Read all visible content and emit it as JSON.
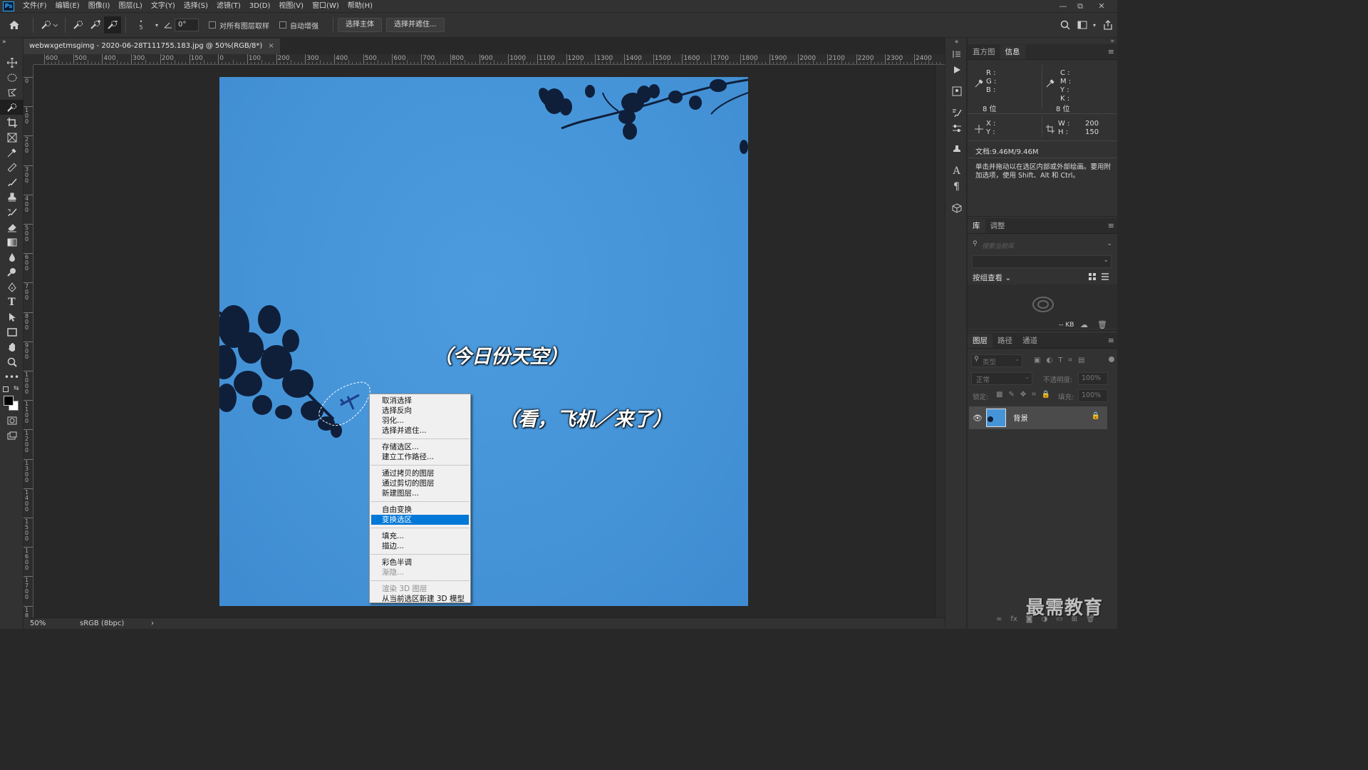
{
  "app": {
    "logo": "Ps"
  },
  "menubar": {
    "items": [
      "文件(F)",
      "编辑(E)",
      "图像(I)",
      "图层(L)",
      "文字(Y)",
      "选择(S)",
      "滤镜(T)",
      "3D(D)",
      "视图(V)",
      "窗口(W)",
      "帮助(H)"
    ]
  },
  "window_controls": {
    "minimize": "—",
    "restore": "⧉",
    "close": "✕"
  },
  "options": {
    "brush_size": "5",
    "angle": "0°",
    "sample_all_layers": "对所有图层取样",
    "auto_enhance": "自动增强",
    "select_subject": "选择主体",
    "select_and_mask": "选择并遮住..."
  },
  "document": {
    "tab_title": "webwxgetmsgimg - 2020-06-28T111755.183.jpg @ 50%(RGB/8*)",
    "close": "×"
  },
  "ruler": {
    "top_labels": [
      "600",
      "500",
      "400",
      "300",
      "200",
      "100",
      "0",
      "100",
      "200",
      "300",
      "400",
      "500",
      "600",
      "700",
      "800",
      "900",
      "1000",
      "1100",
      "1200",
      "1300",
      "1400",
      "1500",
      "1600",
      "1700",
      "1800",
      "1900",
      "2000",
      "2100",
      "2200",
      "2300",
      "2400"
    ],
    "left_labels": [
      "0",
      "1 0 0",
      "2 0 0",
      "3 0 0",
      "4 0 0",
      "5 0 0",
      "6 0 0",
      "7 0 0",
      "8 0 0",
      "9 0 0",
      "1 0 0 0",
      "1 1 0 0",
      "1 2 0 0",
      "1 3 0 0",
      "1 4 0 0",
      "1 5 0 0",
      "1 6 0 0",
      "1 7 0 0",
      "1 8 0 0"
    ]
  },
  "image": {
    "caption1": "（今日份天空）",
    "caption2": "（看，飞机／来了）",
    "sky_color": "#4694d8"
  },
  "context_menu": {
    "groups": [
      [
        {
          "label": "取消选择"
        },
        {
          "label": "选择反向"
        },
        {
          "label": "羽化..."
        },
        {
          "label": "选择并遮住..."
        }
      ],
      [
        {
          "label": "存储选区..."
        },
        {
          "label": "建立工作路径..."
        }
      ],
      [
        {
          "label": "通过拷贝的图层"
        },
        {
          "label": "通过剪切的图层"
        },
        {
          "label": "新建图层..."
        }
      ],
      [
        {
          "label": "自由变换"
        },
        {
          "label": "变换选区",
          "selected": true
        }
      ],
      [
        {
          "label": "填充..."
        },
        {
          "label": "描边..."
        }
      ],
      [
        {
          "label": "彩色半调"
        },
        {
          "label": "渐隐...",
          "disabled": true
        }
      ],
      [
        {
          "label": "渲染 3D 图层",
          "disabled": true
        },
        {
          "label": "从当前选区新建 3D 模型"
        }
      ]
    ]
  },
  "status": {
    "zoom": "50%",
    "color_profile": "sRGB (8bpc)",
    "arrow": "›"
  },
  "info_panel": {
    "tabs": [
      "直方图",
      "信息"
    ],
    "active_tab": "信息",
    "rgb_labels": [
      "R :",
      "G :",
      "B :"
    ],
    "cmyk_labels": [
      "C :",
      "M :",
      "Y :",
      "K :"
    ],
    "bit_left": "8 位",
    "bit_right": "8 位",
    "x_label": "X :",
    "y_label": "Y :",
    "w_label": "W :",
    "h_label": "H :",
    "w_value": "200",
    "h_value": "150",
    "doc_size": "文档:9.46M/9.46M",
    "hint": "单击并拖动以在选区内部或外部绘画。要用附加选项，使用 Shift、Alt 和 Ctrl。"
  },
  "library_panel": {
    "tabs": [
      "库",
      "调整"
    ],
    "active_tab": "库",
    "search_placeholder": "搜索当前库",
    "group_by": "按组查看",
    "size": "-- KB"
  },
  "layers_panel": {
    "tabs": [
      "图层",
      "路径",
      "通道"
    ],
    "active_tab": "图层",
    "filter_placeholder": "类型",
    "blend_mode": "正常",
    "opacity_label": "不透明度:",
    "opacity_value": "100%",
    "lock_label": "锁定:",
    "fill_label": "填充:",
    "fill_value": "100%",
    "layers": [
      {
        "name": "背景",
        "visible": true,
        "locked": true
      }
    ]
  },
  "watermark": "最需教育"
}
